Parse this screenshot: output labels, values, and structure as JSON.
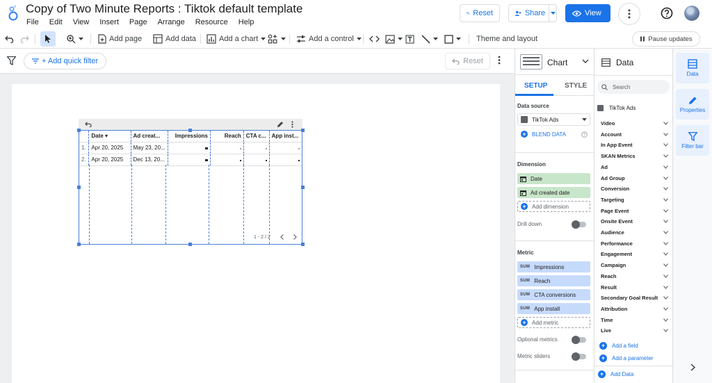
{
  "header": {
    "title": "Copy of Two Minute Reports : Tiktok default template",
    "menus": [
      "File",
      "Edit",
      "View",
      "Insert",
      "Page",
      "Arrange",
      "Resource",
      "Help"
    ],
    "reset_label": "Reset",
    "share_label": "Share",
    "view_label": "View"
  },
  "toolbar": {
    "add_page": "Add page",
    "add_data": "Add data",
    "add_chart": "Add a chart",
    "add_control": "Add a control",
    "theme_layout": "Theme and layout",
    "pause_updates": "Pause updates"
  },
  "filterbar": {
    "quick_filter": "+ Add quick filter",
    "reset": "Reset"
  },
  "table": {
    "columns": [
      "Date ▾",
      "Ad creat...",
      "Impressions",
      "Reach",
      "CTA c...",
      "App inst..."
    ],
    "rows": [
      {
        "idx": "1.",
        "date": "Apr 20, 2025",
        "ad_created": "May 23, 20..."
      },
      {
        "idx": "2.",
        "date": "Apr 20, 2025",
        "ad_created": "Dec 13, 20..."
      }
    ],
    "pager": "1 - 2 / 2"
  },
  "chart_panel": {
    "title": "Chart",
    "tab_setup": "SETUP",
    "tab_style": "STYLE",
    "data_source_label": "Data source",
    "data_source": "TikTok Ads",
    "blend_data": "BLEND DATA",
    "dimension_label": "Dimension",
    "dimensions": [
      "Date",
      "Ad created date"
    ],
    "add_dimension": "Add dimension",
    "drill_down": "Drill down",
    "metric_label": "Metric",
    "metrics": [
      "Impressions",
      "Reach",
      "CTA conversions",
      "App install"
    ],
    "sum_tag": "SUM",
    "add_metric": "Add metric",
    "optional_metrics": "Optional metrics",
    "metric_sliders": "Metric sliders"
  },
  "data_panel": {
    "title": "Data",
    "search_placeholder": "Search",
    "source": "TikTok Ads",
    "groups": [
      "Video",
      "Account",
      "In App Event",
      "SKAN Metrics",
      "Ad",
      "Ad Group",
      "Conversion",
      "Targeting",
      "Page Event",
      "Onsite Event",
      "Audience",
      "Performance",
      "Engagement",
      "Campaign",
      "Reach",
      "Result",
      "Secondary Goal Result",
      "Attribution",
      "Time",
      "Live"
    ],
    "add_field": "Add a field",
    "add_parameter": "Add a parameter",
    "add_data": "Add Data"
  },
  "rail": {
    "data": "Data",
    "properties": "Properties",
    "filter_bar": "Filter bar"
  },
  "colors": {
    "accent": "#1a73e8",
    "dimension_chip": "#c8e6c9",
    "metric_chip": "#c6dafc"
  }
}
